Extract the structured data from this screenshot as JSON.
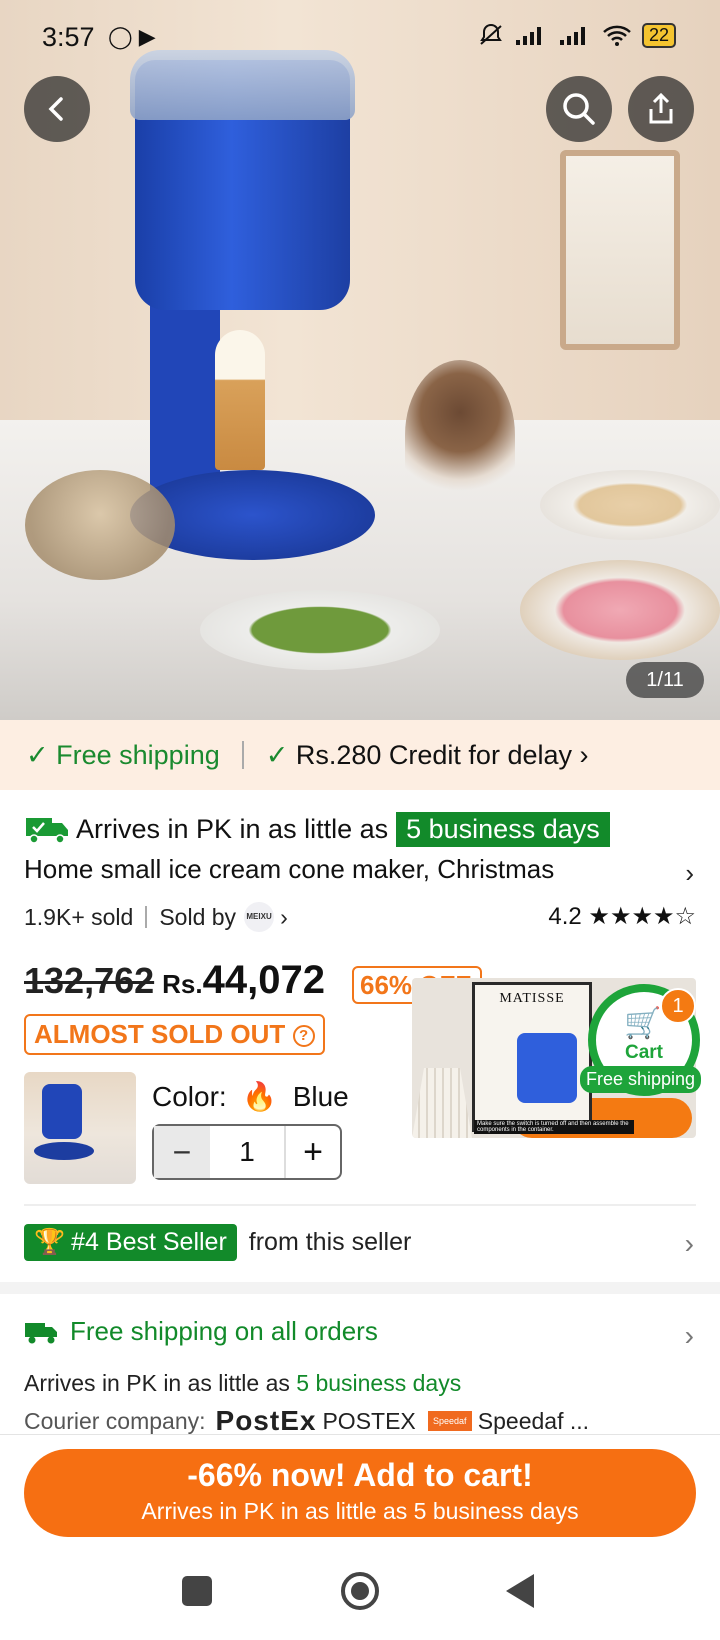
{
  "status_bar": {
    "time": "3:57",
    "left_icons": "◯ ▶",
    "battery": "22"
  },
  "hero": {
    "image_counter": "1/11",
    "icons": [
      "back-icon",
      "search-icon",
      "share-icon"
    ]
  },
  "shipping_strip": {
    "free_shipping": "Free shipping",
    "credit": "Rs.280 Credit for delay"
  },
  "delivery": {
    "arrives_prefix": "Arrives in PK in as little as",
    "arrives_days": "5 business days"
  },
  "product": {
    "title": "Home small ice cream cone maker, Christmas",
    "sold_count": "1.9K+ sold",
    "sold_by_label": "Sold by",
    "seller_logo_text": "MEIXU",
    "rating": "4.2",
    "rating_value": 4.2,
    "rating_max": 5,
    "original_price": "132,762",
    "currency_label": "Rs.",
    "current_price": "44,072",
    "discount_badge": "66% OFF",
    "stock_badge": "ALMOST SOLD OUT",
    "color_label": "Color:",
    "color_value": "Blue",
    "quantity": "1"
  },
  "floating_preview": {
    "poster_text": "MATISSE",
    "caption": "Make sure the switch is turned off and then assemble the components in the container.",
    "cart_label": "Cart",
    "cart_count": "1",
    "cart_free_shipping": "Free shipping"
  },
  "best_seller": {
    "badge": "#4 Best Seller",
    "suffix": "from this seller"
  },
  "shipping_section": {
    "title": "Free shipping on all orders",
    "arrives_prefix": "Arrives in PK in as little as",
    "arrives_days": "5 business days",
    "courier_label": "Courier company:",
    "courier_logo": "PostEx",
    "courier_1": "POSTEX",
    "courier_2_logo": "Speedaf",
    "courier_2": "Speedaf ..."
  },
  "cta": {
    "line1": "-66% now! Add to cart!",
    "line2": "Arrives in PK in as little as 5 business days"
  },
  "colors": {
    "accent_orange": "#f66f12",
    "green": "#128a2a",
    "strip_bg": "#fdeee2"
  }
}
